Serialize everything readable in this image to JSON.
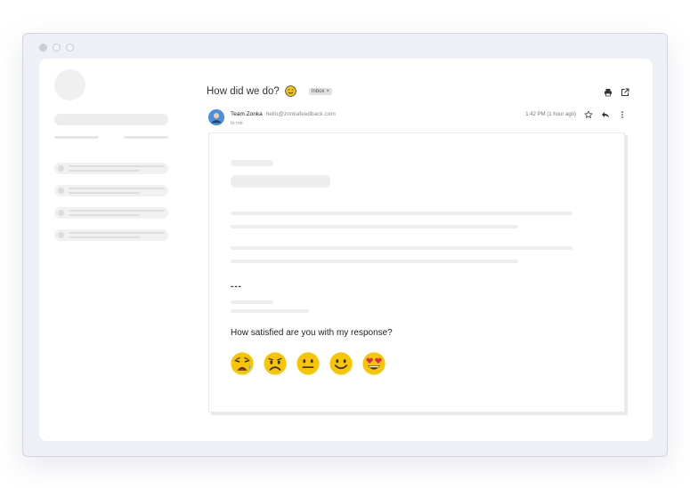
{
  "email": {
    "subject": "How did we do?",
    "subject_icon": "smiling-face-emoji",
    "label_chip": "Inbox",
    "label_chip_close": "×",
    "sender_name": "Team Zonka",
    "sender_email": "hello@zonkafeedback.com",
    "recipient": "to me",
    "time": "1:42 PM (1 hour ago)",
    "separator": "---",
    "question": "How satisfied are you with my response?"
  },
  "toolbar": {
    "icons": [
      "print-icon",
      "open-in-new-window-icon"
    ],
    "row_icons": [
      "star-icon",
      "reply-icon",
      "more-vertical-icon"
    ]
  },
  "rating": {
    "emojis": [
      "very-dissatisfied",
      "dissatisfied",
      "neutral",
      "satisfied",
      "very-satisfied"
    ]
  },
  "colors": {
    "emoji_yellow": "#f7c600",
    "emoji_outline": "#333333",
    "avatar_blue": "#4a8fe0",
    "heart_red": "#e0245e"
  }
}
